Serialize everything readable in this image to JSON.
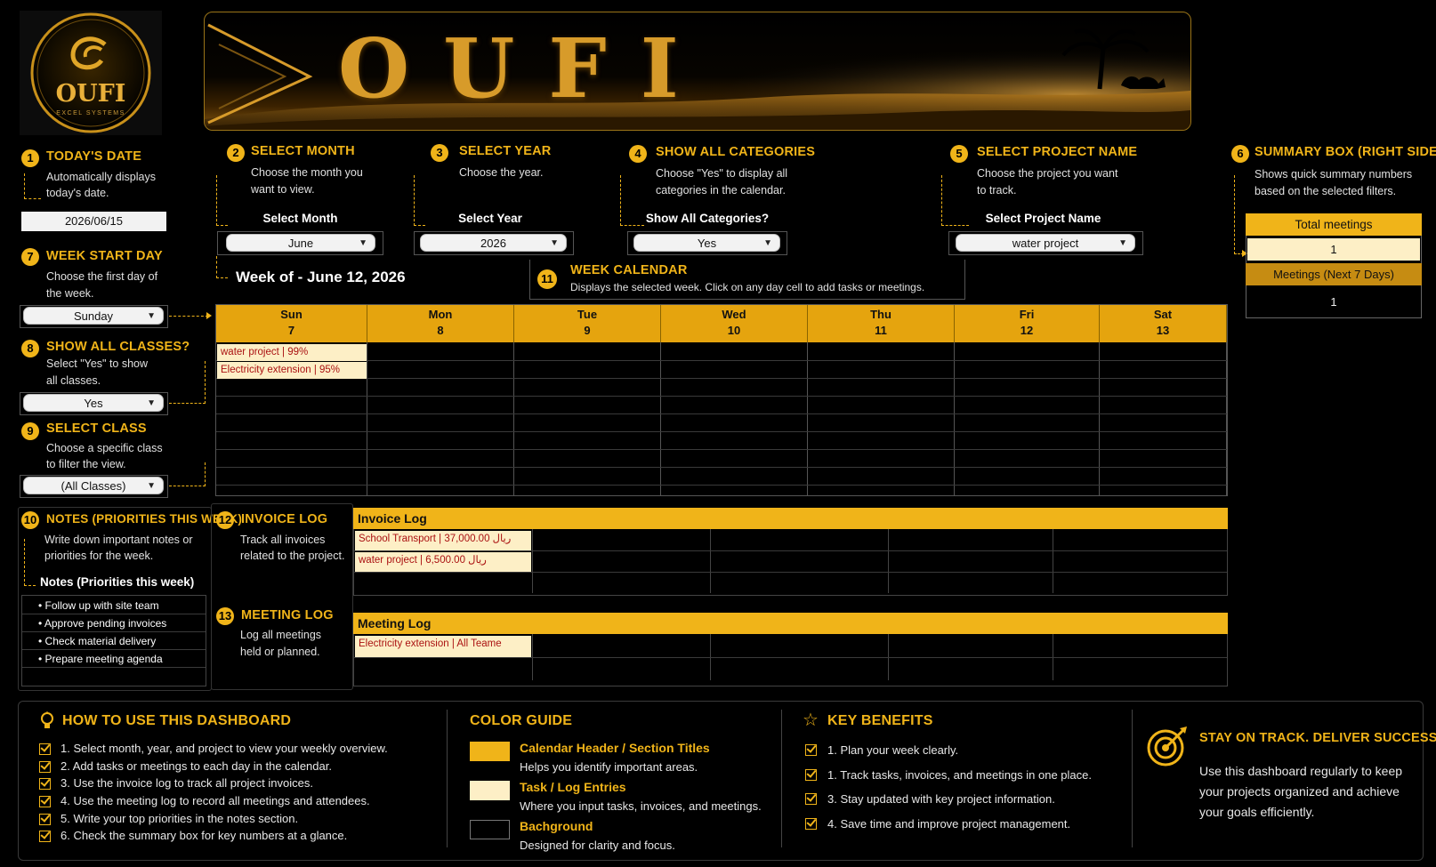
{
  "logo": {
    "text": "OUFI",
    "sub": "EXCEL SYSTEMS"
  },
  "banner": {
    "title": "OUFI"
  },
  "today": {
    "num": "1",
    "title": "TODAY'S DATE",
    "desc1": "Automatically displays",
    "desc2": "today's date.",
    "value": "2026/06/15"
  },
  "week_start": {
    "num": "7",
    "title": "WEEK START DAY",
    "desc1": "Choose the first day of",
    "desc2": "the week.",
    "value": "Sunday"
  },
  "show_classes": {
    "num": "8",
    "title": "SHOW ALL CLASSES?",
    "desc1": "Select \"Yes\" to show",
    "desc2": "all classes.",
    "value": "Yes"
  },
  "select_class": {
    "num": "9",
    "title": "SELECT CLASS",
    "desc1": "Choose a specific class",
    "desc2": "to filter the view.",
    "value": "(All Classes)"
  },
  "select_month": {
    "num": "2",
    "title": "SELECT MONTH",
    "desc1": "Choose the month you",
    "desc2": "want to view.",
    "label": "Select Month",
    "value": "June"
  },
  "select_year": {
    "num": "3",
    "title": "SELECT YEAR",
    "desc1": "Choose the year.",
    "label": "Select Year",
    "value": "2026"
  },
  "show_categories": {
    "num": "4",
    "title": "SHOW ALL CATEGORIES",
    "desc1": "Choose \"Yes\" to display all",
    "desc2": "categories in the calendar.",
    "label": "Show All Categories?",
    "value": "Yes"
  },
  "select_project": {
    "num": "5",
    "title": "SELECT PROJECT NAME",
    "desc1": "Choose the project you want",
    "desc2": "to track.",
    "label": "Select Project Name",
    "value": "water project"
  },
  "summary": {
    "num": "6",
    "title": "SUMMARY BOX (RIGHT SIDE)",
    "desc1": "Shows quick summary numbers",
    "desc2": "based on the selected filters.",
    "total_label": "Total meetings",
    "total_value": "1",
    "next_label": "Meetings (Next 7 Days)",
    "next_value": "1"
  },
  "week_of": "Week of - June 12, 2026",
  "week_calendar": {
    "num": "11",
    "title": "WEEK CALENDAR",
    "desc": "Displays the selected week. Click on any day cell to add tasks or meetings."
  },
  "days": [
    {
      "name": "Sun",
      "date": "7"
    },
    {
      "name": "Mon",
      "date": "8"
    },
    {
      "name": "Tue",
      "date": "9"
    },
    {
      "name": "Wed",
      "date": "10"
    },
    {
      "name": "Thu",
      "date": "11"
    },
    {
      "name": "Fri",
      "date": "12"
    },
    {
      "name": "Sat",
      "date": "13"
    }
  ],
  "calendar_entries": [
    "water project | 99%",
    "Electricity extension | 95%"
  ],
  "notes": {
    "num": "10",
    "title": "NOTES (PRIORITIES THIS WEEK)",
    "desc1": "Write down important notes or",
    "desc2": "priorities for the week.",
    "header": "Notes (Priorities this week)",
    "items": [
      "• Follow up with site team",
      "• Approve pending invoices",
      "• Check material delivery",
      "• Prepare meeting agenda"
    ]
  },
  "invoice_log": {
    "num": "12",
    "title": "INVOICE LOG",
    "desc1": "Track all invoices",
    "desc2": "related to the project.",
    "bar": "Invoice Log",
    "entries": [
      "School Transport | 37,000.00 ريال",
      "water project | 6,500.00 ريال"
    ]
  },
  "meeting_log": {
    "num": "13",
    "title": "MEETING LOG",
    "desc1": "Log all meetings",
    "desc2": "held or planned.",
    "bar": "Meeting Log",
    "entries": [
      "Electricity extension | All Teame"
    ]
  },
  "how_to": {
    "title": "HOW TO USE THIS DASHBOARD",
    "items": [
      "1. Select month, year, and project to view your weekly overview.",
      "2. Add tasks or meetings to each day in the calendar.",
      "3. Use the invoice log to track all project invoices.",
      "4. Use the meeting log to record all meetings and attendees.",
      "5. Write your top priorities in the notes section.",
      "6. Check the summary box for key numbers at a glance."
    ]
  },
  "color_guide": {
    "title": "COLOR GUIDE",
    "items": [
      {
        "title": "Calendar Header / Section Titles",
        "desc": "Helps you identify important areas.",
        "color": "#f0b419"
      },
      {
        "title": "Task / Log Entries",
        "desc": "Where you input tasks, invoices, and meetings.",
        "color": "#fdefc6"
      },
      {
        "title": "Bachground",
        "desc": "Designed for clarity and focus.",
        "color": "#000000"
      }
    ]
  },
  "benefits": {
    "title": "KEY BENEFITS",
    "items": [
      "1. Plan your week clearly.",
      "1. Track tasks, invoices, and meetings in one place.",
      "3. Stay updated with key project information.",
      "4. Save time and improve project management."
    ]
  },
  "stay": {
    "title": "STAY ON TRACK. DELIVER SUCCESS.",
    "desc1": "Use this dashboard regularly to keep",
    "desc2": "your projects organized and achieve",
    "desc3": "your goals efficiently."
  },
  "colors": {
    "accent": "#f0b419",
    "entry": "#fdefc6",
    "entry_text": "#aa1111",
    "background": "#000000"
  }
}
